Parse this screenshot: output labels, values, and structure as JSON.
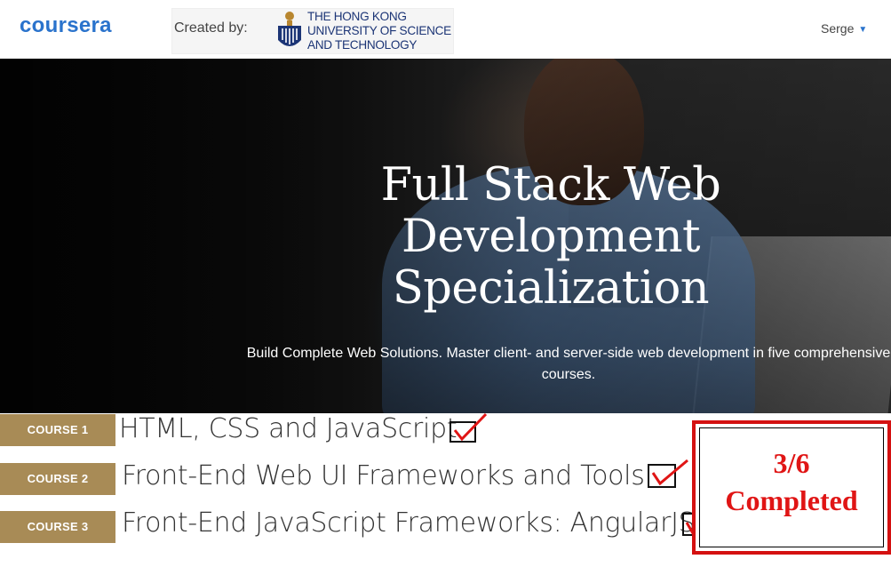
{
  "header": {
    "logo": "coursera",
    "created_by_label": "Created by:",
    "university_name": "THE HONG KONG\nUNIVERSITY OF SCIENCE\nAND TECHNOLOGY",
    "user_name": "Serge"
  },
  "hero": {
    "title": "Full Stack Web Development Specialization",
    "subtitle": "Build Complete Web Solutions. Master client- and server-side web development in five comprehensive courses."
  },
  "courses": [
    {
      "badge": "COURSE 1",
      "title": "HTML, CSS and JavaScript",
      "checked": true
    },
    {
      "badge": "COURSE 2",
      "title": "Front-End Web UI Frameworks and Tools",
      "checked": true
    },
    {
      "badge": "COURSE 3",
      "title": "Front-End JavaScript Frameworks: AngularJS",
      "checked": true
    }
  ],
  "completion": {
    "fraction": "3/6",
    "label": "Completed"
  },
  "colors": {
    "brand": "#2a73cc",
    "badge": "#a88b56",
    "annotation": "#e01515"
  },
  "icons": [
    "university-emblem-icon",
    "caret-down-icon",
    "check-icon"
  ]
}
